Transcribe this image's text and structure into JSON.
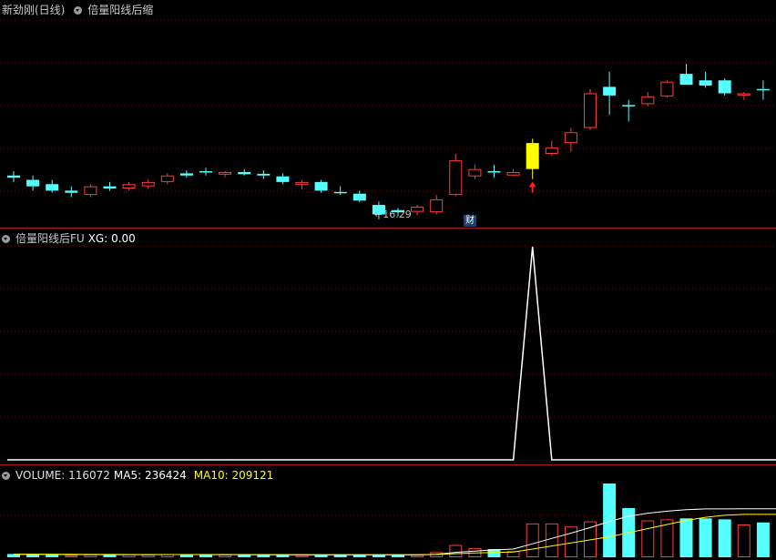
{
  "main_pane": {
    "title": "新劲刚(日线)",
    "indicator": "倍量阳线后缩",
    "low_label": "←16.29",
    "badge": "财"
  },
  "xg_pane": {
    "title": "倍量阳线后FU",
    "value_label": "XG: 0.00"
  },
  "volume_pane": {
    "volume_label": "VOLUME: 116072",
    "ma5_label": "MA5: 236424",
    "ma10_label": "MA10: 209121"
  },
  "colors": {
    "up": "#ff3b3b",
    "down": "#54ffff",
    "signal": "#ffff00",
    "ma5": "#ffffff",
    "ma10": "#ffff00",
    "grid": "#7a0000",
    "separator": "#b0141b"
  },
  "chart_data": [
    {
      "type": "candlestick",
      "title": "新劲刚(日线)",
      "note": "approximate daily OHLC read from screen (price-axis values unlabeled on screen except the 16.29 low marker)",
      "candles": [
        {
          "o": 17.3,
          "h": 17.4,
          "l": 17.15,
          "c": 17.25,
          "dir": "down"
        },
        {
          "o": 17.2,
          "h": 17.3,
          "l": 16.95,
          "c": 17.05,
          "dir": "down"
        },
        {
          "o": 17.1,
          "h": 17.2,
          "l": 16.9,
          "c": 16.95,
          "dir": "down"
        },
        {
          "o": 16.95,
          "h": 17.05,
          "l": 16.8,
          "c": 16.9,
          "dir": "down"
        },
        {
          "o": 16.85,
          "h": 17.1,
          "l": 16.8,
          "c": 17.05,
          "dir": "up"
        },
        {
          "o": 17.05,
          "h": 17.15,
          "l": 16.95,
          "c": 17.0,
          "dir": "down"
        },
        {
          "o": 17.0,
          "h": 17.15,
          "l": 16.95,
          "c": 17.1,
          "dir": "up"
        },
        {
          "o": 17.05,
          "h": 17.2,
          "l": 17.0,
          "c": 17.15,
          "dir": "up"
        },
        {
          "o": 17.15,
          "h": 17.35,
          "l": 17.1,
          "c": 17.3,
          "dir": "up"
        },
        {
          "o": 17.35,
          "h": 17.42,
          "l": 17.25,
          "c": 17.3,
          "dir": "down"
        },
        {
          "o": 17.4,
          "h": 17.48,
          "l": 17.3,
          "c": 17.38,
          "dir": "down"
        },
        {
          "o": 17.32,
          "h": 17.4,
          "l": 17.26,
          "c": 17.38,
          "dir": "up"
        },
        {
          "o": 17.38,
          "h": 17.45,
          "l": 17.3,
          "c": 17.33,
          "dir": "down"
        },
        {
          "o": 17.34,
          "h": 17.42,
          "l": 17.22,
          "c": 17.3,
          "dir": "down"
        },
        {
          "o": 17.28,
          "h": 17.35,
          "l": 17.1,
          "c": 17.15,
          "dir": "down"
        },
        {
          "o": 17.08,
          "h": 17.2,
          "l": 16.98,
          "c": 17.15,
          "dir": "up"
        },
        {
          "o": 17.15,
          "h": 17.2,
          "l": 16.9,
          "c": 16.95,
          "dir": "down"
        },
        {
          "o": 16.92,
          "h": 17.05,
          "l": 16.85,
          "c": 16.9,
          "dir": "down"
        },
        {
          "o": 16.88,
          "h": 16.95,
          "l": 16.68,
          "c": 16.72,
          "dir": "down"
        },
        {
          "o": 16.62,
          "h": 16.7,
          "l": 16.29,
          "c": 16.4,
          "dir": "down"
        },
        {
          "o": 16.45,
          "h": 16.55,
          "l": 16.36,
          "c": 16.5,
          "dir": "down"
        },
        {
          "o": 16.46,
          "h": 16.62,
          "l": 16.38,
          "c": 16.58,
          "dir": "up"
        },
        {
          "o": 16.45,
          "h": 16.85,
          "l": 16.4,
          "c": 16.75,
          "dir": "up"
        },
        {
          "o": 16.85,
          "h": 17.8,
          "l": 16.82,
          "c": 17.65,
          "dir": "up"
        },
        {
          "o": 17.28,
          "h": 17.55,
          "l": 17.22,
          "c": 17.45,
          "dir": "up"
        },
        {
          "o": 17.4,
          "h": 17.55,
          "l": 17.25,
          "c": 17.4,
          "dir": "down"
        },
        {
          "o": 17.3,
          "h": 17.45,
          "l": 17.28,
          "c": 17.38,
          "dir": "up"
        },
        {
          "o": 17.45,
          "h": 18.15,
          "l": 17.22,
          "c": 18.05,
          "dir": "signal"
        },
        {
          "o": 17.8,
          "h": 18.1,
          "l": 17.75,
          "c": 17.95,
          "dir": "up"
        },
        {
          "o": 18.05,
          "h": 18.4,
          "l": 17.85,
          "c": 18.3,
          "dir": "up"
        },
        {
          "o": 18.4,
          "h": 19.3,
          "l": 18.35,
          "c": 19.2,
          "dir": "up"
        },
        {
          "o": 19.35,
          "h": 19.7,
          "l": 18.7,
          "c": 19.15,
          "dir": "down"
        },
        {
          "o": 18.9,
          "h": 19.05,
          "l": 18.55,
          "c": 18.93,
          "dir": "down"
        },
        {
          "o": 18.95,
          "h": 19.23,
          "l": 18.9,
          "c": 19.13,
          "dir": "up"
        },
        {
          "o": 19.13,
          "h": 19.5,
          "l": 19.1,
          "c": 19.47,
          "dir": "up"
        },
        {
          "o": 19.65,
          "h": 19.88,
          "l": 19.4,
          "c": 19.4,
          "dir": "down"
        },
        {
          "o": 19.5,
          "h": 19.7,
          "l": 19.33,
          "c": 19.38,
          "dir": "down"
        },
        {
          "o": 19.5,
          "h": 19.55,
          "l": 19.15,
          "c": 19.2,
          "dir": "down"
        },
        {
          "o": 19.15,
          "h": 19.23,
          "l": 19.05,
          "c": 19.2,
          "dir": "up"
        },
        {
          "o": 19.3,
          "h": 19.5,
          "l": 19.05,
          "c": 19.28,
          "dir": "down"
        },
        {
          "o": 19.15,
          "h": 19.3,
          "l": 19.1,
          "c": 19.25,
          "dir": "up"
        }
      ],
      "annotations": {
        "low_marker": "16.29",
        "signal_bar_index": 27,
        "event_badge": "财"
      }
    },
    {
      "type": "line",
      "title": "倍量阳线后FU",
      "series": [
        {
          "name": "XG",
          "values": [
            0,
            0,
            0,
            0,
            0,
            0,
            0,
            0,
            0,
            0,
            0,
            0,
            0,
            0,
            0,
            0,
            0,
            0,
            0,
            0,
            0,
            0,
            0,
            0,
            0,
            0,
            0,
            1,
            0,
            0,
            0,
            0,
            0,
            0,
            0,
            0,
            0,
            0,
            0,
            0,
            0
          ]
        }
      ],
      "ylim": [
        0,
        1
      ]
    },
    {
      "type": "bar",
      "title": "VOLUME",
      "series": [
        {
          "name": "VOLUME",
          "values": [
            16000,
            14000,
            12000,
            11000,
            13000,
            12000,
            14000,
            13000,
            15000,
            13000,
            12000,
            13000,
            12000,
            12000,
            12000,
            11000,
            12000,
            12000,
            13000,
            12000,
            11000,
            12000,
            25000,
            60000,
            45000,
            40000,
            30000,
            165000,
            165000,
            150000,
            175000,
            360000,
            240000,
            180000,
            185000,
            190000,
            190000,
            185000,
            160000,
            170000,
            170000
          ],
          "dirs": [
            "down",
            "down",
            "down",
            "up",
            "up",
            "down",
            "up",
            "up",
            "up",
            "down",
            "down",
            "up",
            "down",
            "down",
            "down",
            "up",
            "down",
            "down",
            "down",
            "down",
            "down",
            "up",
            "up",
            "up",
            "up",
            "down",
            "up",
            "signal",
            "up",
            "up",
            "up",
            "down",
            "down",
            "up",
            "up",
            "down",
            "down",
            "down",
            "up",
            "down",
            "up"
          ]
        },
        {
          "name": "MA5",
          "values": [
            14000,
            14000,
            13800,
            13500,
            13200,
            12800,
            12800,
            12800,
            13400,
            13400,
            13400,
            13200,
            13000,
            12600,
            12200,
            12000,
            11800,
            11800,
            11800,
            11800,
            11800,
            11800,
            14600,
            23800,
            30200,
            36000,
            40000,
            66000,
            92000,
            118000,
            145000,
            175000,
            200000,
            215000,
            225000,
            232000,
            236000,
            236000,
            236424,
            236424,
            236424
          ]
        },
        {
          "name": "MA10",
          "values": [
            14500,
            14400,
            14200,
            14000,
            13800,
            13600,
            13500,
            13300,
            13300,
            13200,
            13100,
            13000,
            12900,
            12800,
            12700,
            12600,
            12500,
            12400,
            12400,
            12300,
            12200,
            12200,
            13400,
            17600,
            20800,
            23500,
            25600,
            40000,
            55000,
            70000,
            85000,
            100000,
            120000,
            140000,
            160000,
            180000,
            195000,
            205000,
            209121,
            209121,
            209121
          ]
        }
      ]
    }
  ]
}
